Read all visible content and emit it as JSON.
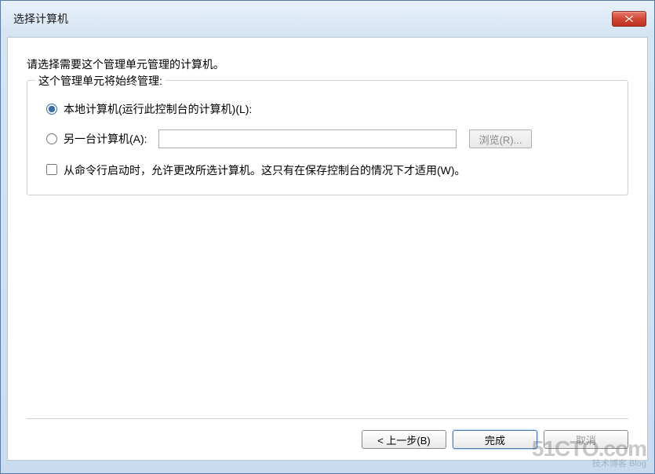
{
  "window": {
    "title": "选择计算机"
  },
  "content": {
    "instruction": "请选择需要这个管理单元管理的计算机。",
    "group_legend": "这个管理单元将始终管理:",
    "radio_local": "本地计算机(运行此控制台的计算机)(L):",
    "radio_another": "另一台计算机(A):",
    "computer_value": "",
    "browse_label": "浏览(R)...",
    "checkbox_cmdline": "从命令行启动时，允许更改所选计算机。这只有在保存控制台的情况下才适用(W)。"
  },
  "buttons": {
    "back": "< 上一步(B)",
    "finish": "完成",
    "cancel": "取消"
  },
  "watermark": {
    "main": "51CTO.com",
    "sub": "技术博客 Blog"
  }
}
